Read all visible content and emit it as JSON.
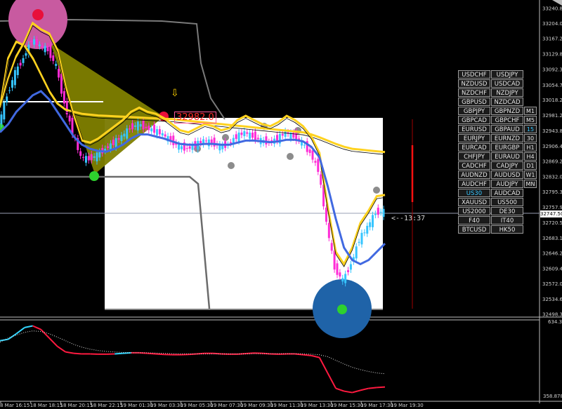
{
  "chart_data": [
    {
      "type": "line",
      "instrument": "US30",
      "ylim": [
        32498.3,
        33240.8
      ],
      "y_ticks": [
        33240.8,
        33204.0,
        33167.2,
        33129.8,
        33092.3,
        33054.7,
        33018.2,
        32981.2,
        32943.8,
        32906.4,
        32869.2,
        32832.0,
        32795.3,
        32757.9,
        32720.5,
        32683.1,
        32646.2,
        32609.4,
        32572.0,
        32534.6,
        32498.3
      ],
      "x_ticks": [
        "8 Mar 16:15",
        "18 Mar 18:15",
        "18 Mar 20:15",
        "18 Mar 22:15",
        "19 Mar 01:30",
        "19 Mar 03:30",
        "19 Mar 05:30",
        "19 Mar 07:30",
        "19 Mar 09:30",
        "19 Mar 11:30",
        "19 Mar 13:30",
        "19 Mar 15:30",
        "19 Mar 17:30",
        "19 Mar 19:30"
      ],
      "current_price": "32747.50",
      "current_price_value": 32747.5,
      "price_label": "32982.0",
      "countdown": "<--13:37",
      "signal_arrow": "⇩",
      "series": [
        {
          "role": "close",
          "values": [
            32960,
            33030,
            33085,
            33120,
            33165,
            33150,
            33140,
            33100,
            33010,
            32940,
            32880,
            32875,
            32885,
            32900,
            32915,
            32930,
            32950,
            32960,
            32950,
            32945,
            32935,
            32920,
            32905,
            32900,
            32910,
            32920,
            32915,
            32905,
            32910,
            32930,
            32940,
            32930,
            32920,
            32915,
            32925,
            32940,
            32930,
            32915,
            32890,
            32850,
            32720,
            32610,
            32580,
            32620,
            32680,
            32710,
            32745,
            32748
          ]
        },
        {
          "role": "upper_band",
          "values": [
            33000,
            33120,
            33160,
            33150,
            33120,
            33080,
            33040,
            33010,
            32995,
            32990,
            32985,
            32983,
            32981,
            32980,
            32979,
            32978,
            32977,
            32976,
            32975,
            32974,
            32973,
            32972,
            32970,
            32968,
            32966,
            32964,
            32962,
            32960,
            32958,
            32956,
            32954,
            32952,
            32950,
            32948,
            32946,
            32944,
            32942,
            32940,
            32935,
            32928,
            32920,
            32912,
            32905,
            32900,
            32898,
            32896,
            32894,
            32892
          ]
        },
        {
          "role": "ma_blue",
          "values": [
            32940,
            32960,
            32990,
            33010,
            33030,
            33040,
            33020,
            32990,
            32960,
            32930,
            32910,
            32900,
            32895,
            32893,
            32900,
            32910,
            32925,
            32935,
            32935,
            32930,
            32925,
            32918,
            32912,
            32910,
            32910,
            32912,
            32912,
            32910,
            32910,
            32915,
            32920,
            32920,
            32918,
            32916,
            32918,
            32922,
            32922,
            32918,
            32905,
            32880,
            32810,
            32730,
            32660,
            32630,
            32620,
            32630,
            32650,
            32670
          ]
        }
      ]
    },
    {
      "type": "line",
      "role": "oscillator",
      "ylim": [
        358.8783,
        634.3163
      ],
      "y_top_label": "634.3163",
      "y_bottom_label": "358.8783",
      "series": [
        {
          "role": "main",
          "values": [
            565,
            570,
            590,
            612,
            618,
            605,
            575,
            545,
            525,
            520,
            518,
            518,
            517,
            517,
            518,
            520,
            522,
            522,
            520,
            518,
            516,
            515,
            515,
            516,
            518,
            520,
            520,
            518,
            517,
            517,
            519,
            521,
            520,
            518,
            517,
            518,
            518,
            515,
            512,
            505,
            450,
            395,
            385,
            380,
            388,
            395,
            398,
            400
          ]
        },
        {
          "role": "signal",
          "values": [
            560,
            575,
            585,
            595,
            600,
            598,
            590,
            578,
            565,
            552,
            542,
            535,
            530,
            527,
            525,
            523,
            522,
            522,
            522,
            521,
            520,
            519,
            518,
            518,
            518,
            518,
            518,
            518,
            518,
            518,
            518,
            519,
            519,
            519,
            519,
            519,
            519,
            518,
            517,
            515,
            508,
            495,
            482,
            470,
            462,
            455,
            450,
            447
          ]
        }
      ]
    }
  ],
  "symbol_panel": {
    "rows": [
      {
        "a": "USDCHF",
        "b": "USDJPY",
        "tf": ""
      },
      {
        "a": "NZDUSD",
        "b": "USDCAD",
        "tf": ""
      },
      {
        "a": "NZDCHF",
        "b": "NZDJPY",
        "tf": ""
      },
      {
        "a": "GBPUSD",
        "b": "NZDCAD",
        "tf": ""
      },
      {
        "a": "GBPJPY",
        "b": "GBPNZD",
        "tf": "M1"
      },
      {
        "a": "GBPCAD",
        "b": "GBPCHF",
        "tf": "M5"
      },
      {
        "a": "EURUSD",
        "b": "GBPAUD",
        "tf": "15"
      },
      {
        "a": "EURJPY",
        "b": "EURNZD",
        "tf": "30"
      },
      {
        "a": "EURCAD",
        "b": "EURGBP",
        "tf": "H1"
      },
      {
        "a": "CHFJPY",
        "b": "EURAUD",
        "tf": "H4"
      },
      {
        "a": "CADCHF",
        "b": "CADJPY",
        "tf": "D1"
      },
      {
        "a": "AUDNZD",
        "b": "AUDUSD",
        "tf": "W1"
      },
      {
        "a": "AUDCHF",
        "b": "AUDJPY",
        "tf": "MN"
      },
      {
        "a": "US30",
        "b": "AUDCAD",
        "tf": ""
      },
      {
        "a": "XAUUSD",
        "b": "US500",
        "tf": ""
      },
      {
        "a": "US2000",
        "b": "DE30",
        "tf": ""
      },
      {
        "a": "F40",
        "b": "IT40",
        "tf": ""
      },
      {
        "a": "BTCUSD",
        "b": "HK50",
        "tf": ""
      }
    ],
    "active_symbol": "US30",
    "active_timeframe": "15"
  },
  "colors": {
    "background": "#000000",
    "bull_candle": "#36c5ff",
    "bear_candle": "#ff2bd6",
    "band_yellow": "#ffd21f",
    "ma_blue": "#4169e1",
    "channel_gray": "#808080",
    "osc_red": "#ff1a40",
    "osc_cyan": "#33d6ff"
  }
}
